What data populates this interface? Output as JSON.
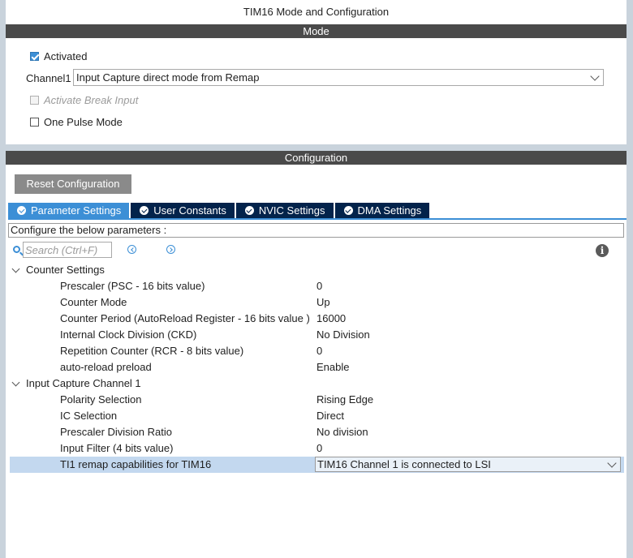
{
  "window": {
    "title": "TIM16 Mode and Configuration"
  },
  "mode": {
    "header": "Mode",
    "activated_label": "Activated",
    "activated_checked": true,
    "channel1_label": "Channel1",
    "channel1_value": "Input Capture direct mode from Remap",
    "break_input_label": "Activate Break Input",
    "break_input_enabled": false,
    "one_pulse_label": "One Pulse Mode",
    "one_pulse_checked": false
  },
  "configuration": {
    "header": "Configuration",
    "reset_label": "Reset Configuration",
    "tabs": [
      {
        "label": "Parameter Settings",
        "active": true
      },
      {
        "label": "User Constants",
        "active": false
      },
      {
        "label": "NVIC Settings",
        "active": false
      },
      {
        "label": "DMA Settings",
        "active": false
      }
    ],
    "params_caption": "Configure the below parameters :",
    "search_placeholder": "Search (Ctrl+F)",
    "groups": [
      {
        "title": "Counter Settings",
        "params": [
          {
            "name": "Prescaler (PSC - 16 bits value)",
            "value": "0"
          },
          {
            "name": "Counter Mode",
            "value": "Up"
          },
          {
            "name": "Counter Period (AutoReload Register - 16 bits value )",
            "value": "16000"
          },
          {
            "name": "Internal Clock Division (CKD)",
            "value": "No Division"
          },
          {
            "name": "Repetition Counter (RCR - 8 bits value)",
            "value": "0"
          },
          {
            "name": "auto-reload preload",
            "value": "Enable"
          }
        ]
      },
      {
        "title": "Input Capture Channel 1",
        "params": [
          {
            "name": "Polarity Selection",
            "value": "Rising Edge"
          },
          {
            "name": "IC Selection",
            "value": "Direct"
          },
          {
            "name": "Prescaler Division Ratio",
            "value": "No division"
          },
          {
            "name": "Input Filter (4 bits value)",
            "value": "0"
          },
          {
            "name": "TI1 remap capabilities for TIM16",
            "value": "TIM16 Channel 1 is connected to LSI",
            "selected": true
          }
        ]
      }
    ]
  },
  "colors": {
    "accent": "#3c8fd6",
    "tab_dark": "#03234b",
    "header": "#4a4a4a",
    "selected_row": "#c3d8ef"
  }
}
